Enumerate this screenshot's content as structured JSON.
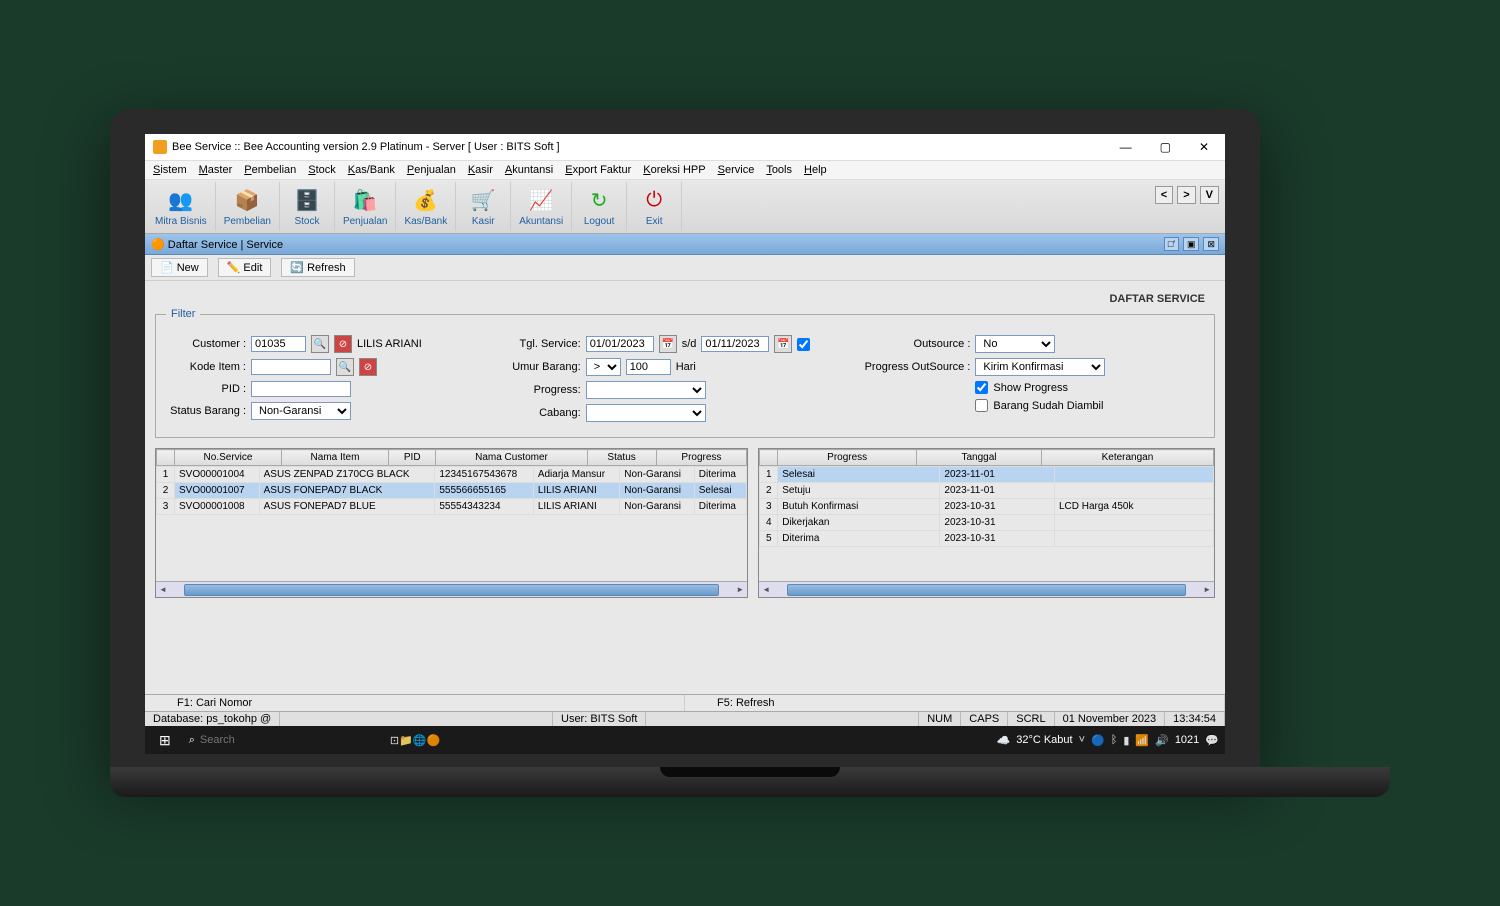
{
  "title": "Bee Service :: Bee Accounting version 2.9 Platinum - Server  [ User : BITS Soft ]",
  "menubar": [
    "Sistem",
    "Master",
    "Pembelian",
    "Stock",
    "Kas/Bank",
    "Penjualan",
    "Kasir",
    "Akuntansi",
    "Export Faktur",
    "Koreksi HPP",
    "Service",
    "Tools",
    "Help"
  ],
  "toolbar": [
    {
      "label": "Mitra Bisnis",
      "icon": "👥"
    },
    {
      "label": "Pembelian",
      "icon": "📦"
    },
    {
      "label": "Stock",
      "icon": "🗄️"
    },
    {
      "label": "Penjualan",
      "icon": "🛍️"
    },
    {
      "label": "Kas/Bank",
      "icon": "💰"
    },
    {
      "label": "Kasir",
      "icon": "🛒"
    },
    {
      "label": "Akuntansi",
      "icon": "📈"
    },
    {
      "label": "Logout",
      "icon": "↻"
    },
    {
      "label": "Exit",
      "icon": "⏻"
    }
  ],
  "subwindow_title": "Daftar Service | Service",
  "subtoolbar": {
    "new": "New",
    "edit": "Edit",
    "refresh": "Refresh"
  },
  "panel_title": "DAFTAR SERVICE",
  "filter": {
    "legend": "Filter",
    "customer_label": "Customer :",
    "customer_value": "01035",
    "customer_name": "LILIS ARIANI",
    "kode_item_label": "Kode Item :",
    "kode_item_value": "",
    "pid_label": "PID :",
    "pid_value": "",
    "status_label": "Status Barang :",
    "status_value": "Non-Garansi",
    "tgl_label": "Tgl. Service:",
    "tgl_from": "01/01/2023",
    "tgl_sep": "s/d",
    "tgl_to": "01/11/2023",
    "umur_label": "Umur Barang:",
    "umur_op": ">",
    "umur_val": "100",
    "umur_unit": "Hari",
    "progress_label": "Progress:",
    "progress_value": "",
    "cabang_label": "Cabang:",
    "cabang_value": "",
    "outsource_label": "Outsource :",
    "outsource_value": "No",
    "po_label": "Progress OutSource :",
    "po_value": "Kirim Konfirmasi",
    "show_progress": "Show Progress",
    "barang_ambil": "Barang Sudah Diambil"
  },
  "table1": {
    "headers": [
      "No.Service",
      "Nama Item",
      "PID",
      "Nama Customer",
      "Status",
      "Progress"
    ],
    "rows": [
      {
        "n": "1",
        "vals": [
          "SVO00001004",
          "ASUS ZENPAD Z170CG BLACK",
          "12345167543678",
          "Adiarja Mansur",
          "Non-Garansi",
          "Diterima"
        ]
      },
      {
        "n": "2",
        "vals": [
          "SVO00001007",
          "ASUS FONEPAD7 BLACK",
          "555566655165",
          "LILIS ARIANI",
          "Non-Garansi",
          "Selesai"
        ],
        "sel": true
      },
      {
        "n": "3",
        "vals": [
          "SVO00001008",
          "ASUS FONEPAD7 BLUE",
          "55554343234",
          "LILIS ARIANI",
          "Non-Garansi",
          "Diterima"
        ]
      }
    ]
  },
  "table2": {
    "headers": [
      "Progress",
      "Tanggal",
      "Keterangan"
    ],
    "rows": [
      {
        "n": "1",
        "vals": [
          "Selesai",
          "2023-11-01",
          ""
        ],
        "sel": true
      },
      {
        "n": "2",
        "vals": [
          "Setuju",
          "2023-11-01",
          ""
        ]
      },
      {
        "n": "3",
        "vals": [
          "Butuh Konfirmasi",
          "2023-10-31",
          "LCD Harga 450k"
        ]
      },
      {
        "n": "4",
        "vals": [
          "Dikerjakan",
          "2023-10-31",
          ""
        ]
      },
      {
        "n": "5",
        "vals": [
          "Diterima",
          "2023-10-31",
          ""
        ]
      }
    ]
  },
  "fnbar": {
    "f1": "F1: Cari Nomor",
    "f5": "F5: Refresh"
  },
  "statusbar": {
    "db": "Database: ps_tokohp @",
    "user": "User: BITS Soft",
    "num": "NUM",
    "caps": "CAPS",
    "scrl": "SCRL",
    "date": "01 November 2023",
    "time": "13:34:54"
  },
  "taskbar": {
    "search_placeholder": "Search",
    "weather": "32°C Kabut",
    "clock": "1021"
  }
}
